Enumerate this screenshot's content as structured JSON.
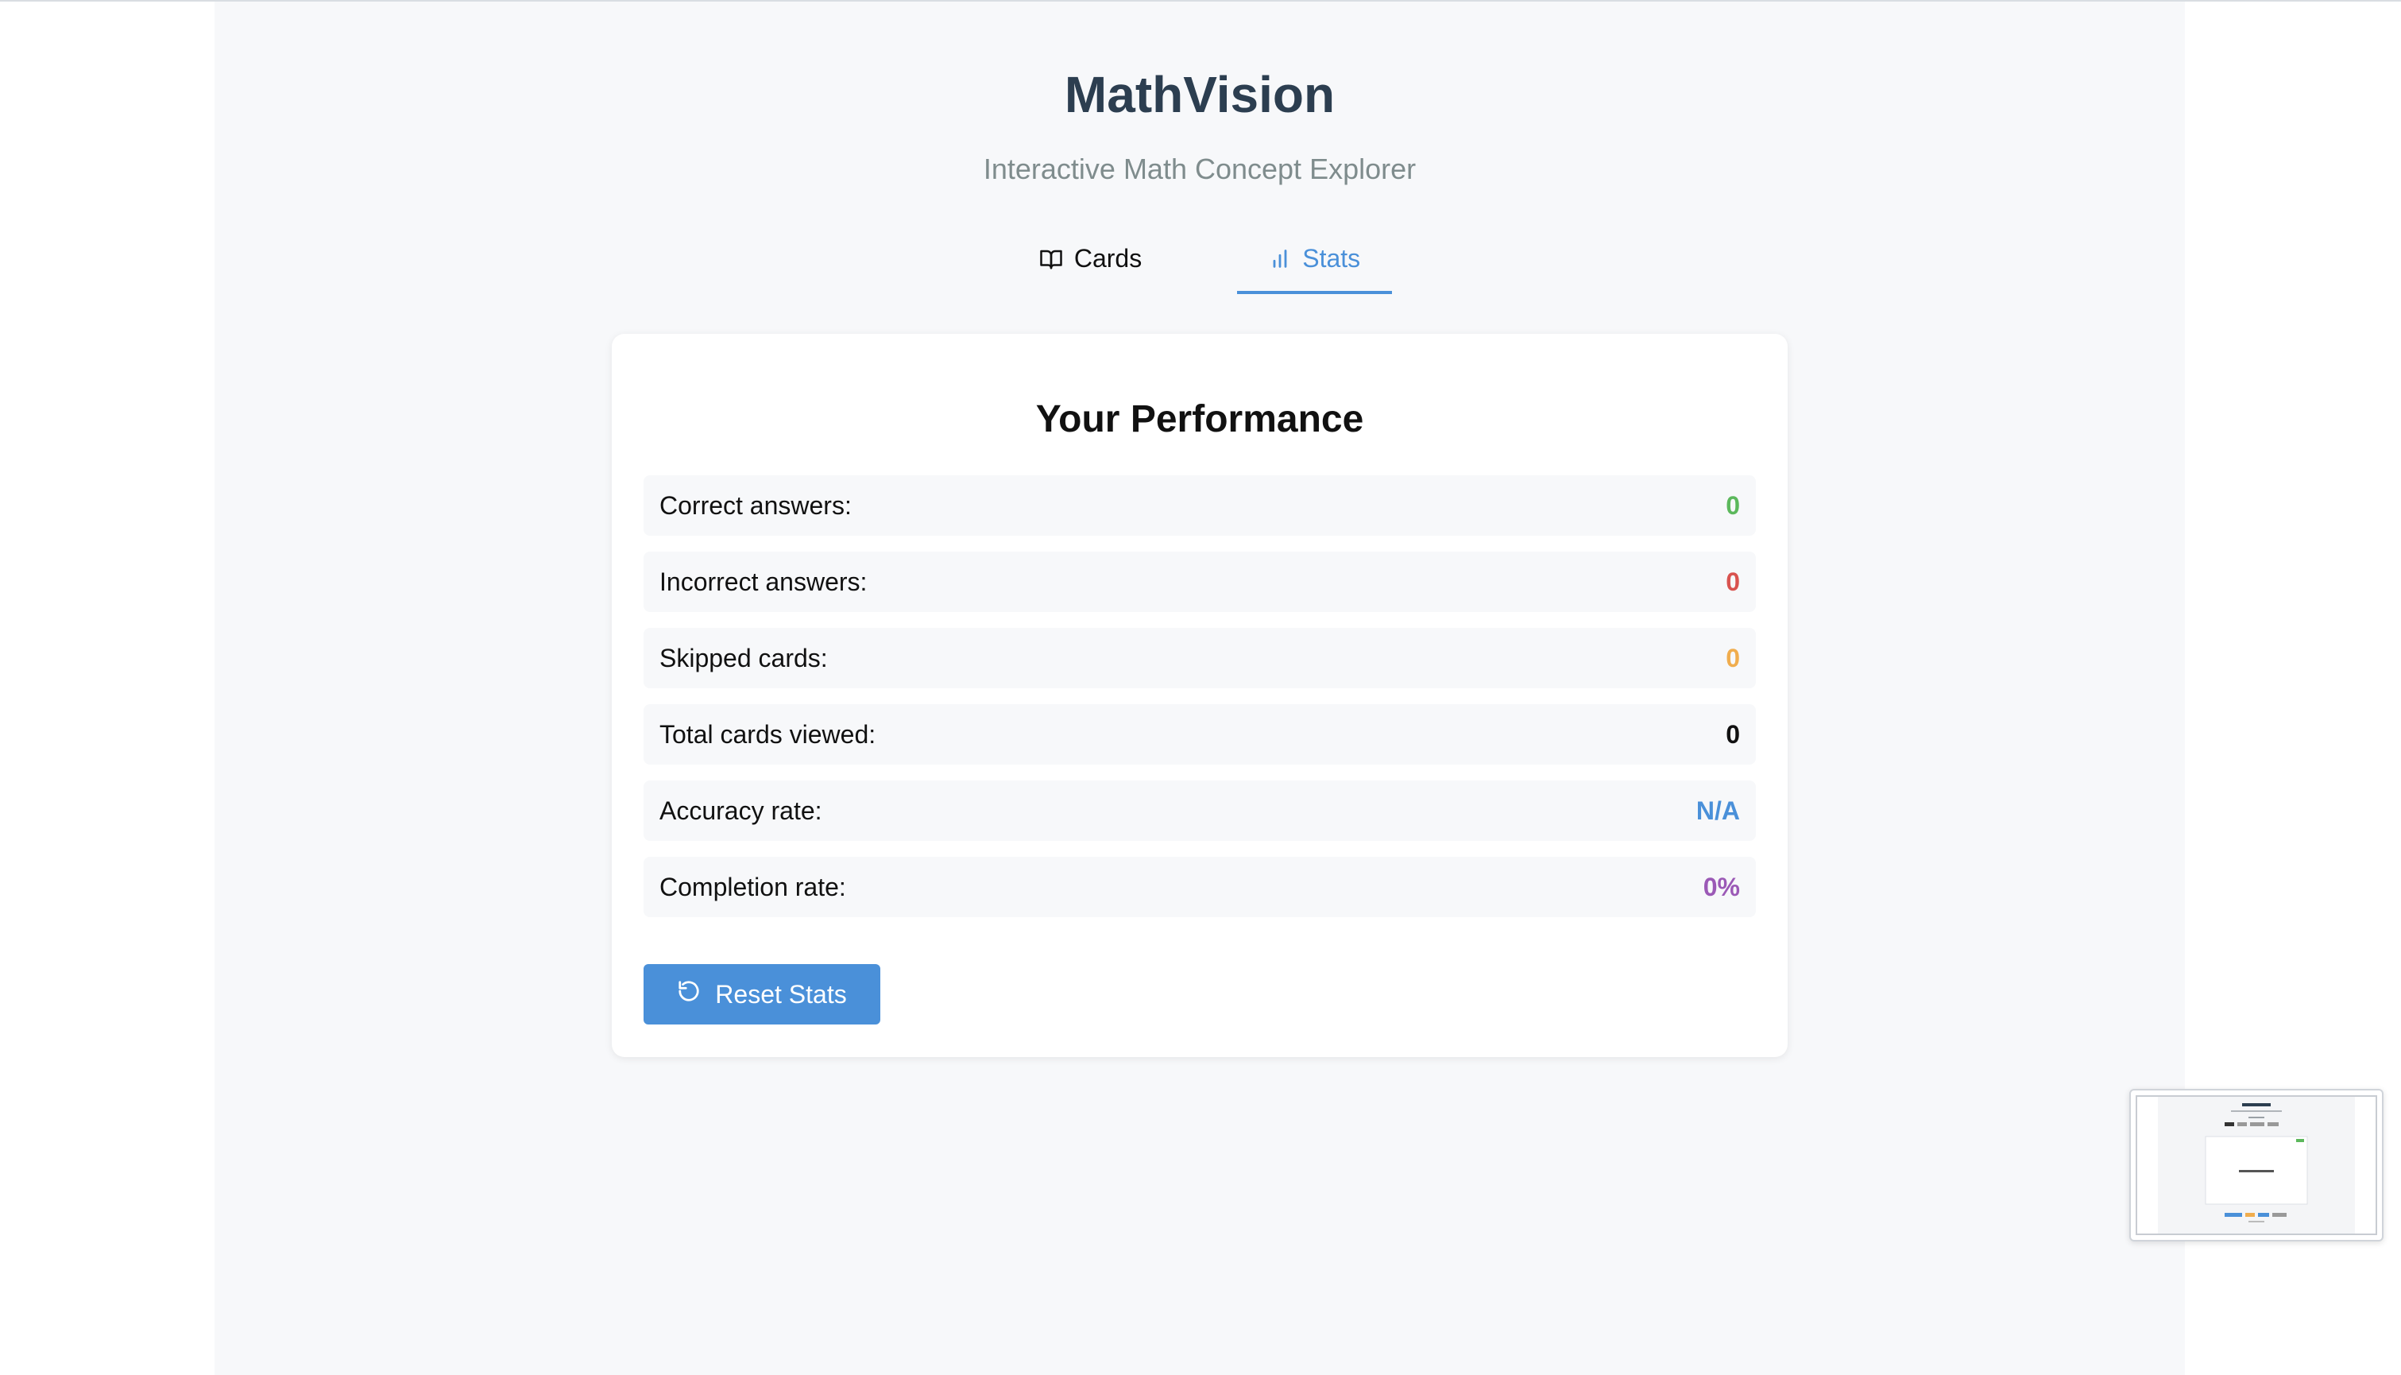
{
  "app": {
    "title": "MathVision",
    "subtitle": "Interactive Math Concept Explorer"
  },
  "tabs": [
    {
      "label": "Cards",
      "icon": "book-open-icon",
      "active": false
    },
    {
      "label": "Stats",
      "icon": "bar-chart-icon",
      "active": true
    }
  ],
  "performance": {
    "title": "Your Performance",
    "rows": [
      {
        "label": "Correct answers:",
        "value": "0",
        "color": "#5cb85c"
      },
      {
        "label": "Incorrect answers:",
        "value": "0",
        "color": "#d9534f"
      },
      {
        "label": "Skipped cards:",
        "value": "0",
        "color": "#f0ad4e"
      },
      {
        "label": "Total cards viewed:",
        "value": "0",
        "color": "#111111"
      },
      {
        "label": "Accuracy rate:",
        "value": "N/A",
        "color": "#4a90d9"
      },
      {
        "label": "Completion rate:",
        "value": "0%",
        "color": "#9b59b6"
      }
    ],
    "reset_label": "Reset Stats"
  },
  "colors": {
    "accent": "#4a90d9",
    "title": "#2c3e50",
    "subtitle": "#7f8c8d",
    "background": "#f7f8fa"
  }
}
